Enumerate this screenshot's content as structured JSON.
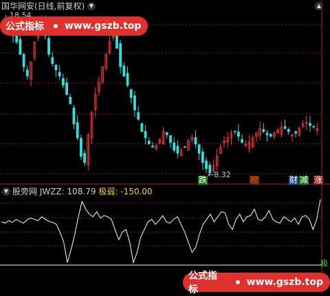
{
  "header": {
    "title": "国华网安(日线,前复权)",
    "high_price_label": "18.54",
    "low_price_label": "8.32"
  },
  "indicator": {
    "name": "股旁网",
    "value_text": "JWZZ: 108.79",
    "weak_label": "极弱:",
    "weak_value": "-150.00",
    "baseline_marker": "极"
  },
  "watermark": {
    "left_text": "公式指标",
    "url": "www.gszb.top"
  },
  "signals": [
    {
      "text": "跌",
      "color": "#ffffff",
      "bg": "#1a7a1a"
    },
    {
      "text": "榜",
      "color": "#ff3030",
      "bg": "#5a3a00"
    },
    {
      "text": "财",
      "color": "#ffffff",
      "bg": "#1a4aa0"
    },
    {
      "text": "减",
      "color": "#ffffff",
      "bg": "#1a7a1a"
    },
    {
      "text": "涨",
      "color": "#ffffff",
      "bg": "#a01a1a"
    }
  ],
  "colors": {
    "up": "#ff3b3b",
    "down": "#2fe0e0",
    "grid": "#a01818",
    "baseline": "#ffff80",
    "indicator_line": "#ffffff"
  },
  "icons": {
    "title_toggle": "chevron-down-icon",
    "indicator_toggle": "chevron-down-icon",
    "top_right": "chevron-up-icon"
  },
  "chart_data": [
    {
      "type": "candlestick",
      "title": "国华网安(日线,前复权)",
      "y_high": 18.54,
      "y_low": 8.32,
      "close_trend": [
        18.0,
        17.5,
        17.2,
        16.8,
        16.0,
        15.2,
        14.6,
        15.5,
        16.8,
        17.6,
        18.2,
        17.2,
        16.0,
        15.4,
        15.0,
        14.6,
        14.0,
        13.4,
        12.8,
        11.5,
        10.6,
        9.4,
        9.0,
        10.8,
        12.2,
        13.4,
        14.2,
        15.2,
        16.0,
        16.8,
        17.2,
        16.4,
        15.2,
        14.6,
        14.0,
        13.2,
        12.4,
        11.8,
        11.0,
        10.6,
        10.2,
        10.0,
        10.1,
        10.5,
        11.0,
        10.8,
        10.3,
        9.8,
        9.6,
        9.8,
        10.0,
        10.4,
        10.6,
        10.2,
        9.6,
        9.0,
        8.6,
        8.32,
        8.8,
        9.4,
        10.0,
        10.4,
        10.6,
        10.9,
        11.0,
        10.7,
        10.3,
        10.2,
        10.3,
        10.6,
        10.9,
        11.2,
        11.0,
        10.8,
        10.7,
        10.9,
        11.1,
        11.3,
        11.2,
        11.0,
        10.8,
        10.9,
        11.2,
        11.5,
        11.6,
        11.4,
        11.3,
        11.2
      ]
    },
    {
      "type": "line",
      "series": [
        {
          "name": "JWZZ",
          "values": [
            20,
            15,
            25,
            18,
            30,
            22,
            15,
            28,
            35,
            30,
            25,
            40,
            30,
            22,
            18,
            10,
            -20,
            -60,
            -140,
            -90,
            -30,
            40,
            100,
            70,
            50,
            40,
            60,
            35,
            45,
            40,
            30,
            -10,
            -50,
            -20,
            -10,
            -60,
            -140,
            -100,
            -40,
            -10,
            20,
            30,
            10,
            25,
            45,
            20,
            15,
            30,
            40,
            10,
            -20,
            -60,
            -100,
            -80,
            -30,
            10,
            30,
            50,
            20,
            40,
            60,
            55,
            10,
            -10,
            30,
            50,
            20,
            40,
            45,
            70,
            30,
            25,
            40,
            65,
            30,
            20,
            15,
            40,
            30,
            20,
            35,
            10,
            40,
            45,
            30,
            -10,
            30,
            108.79
          ]
        }
      ],
      "baseline": -150.0
    }
  ]
}
